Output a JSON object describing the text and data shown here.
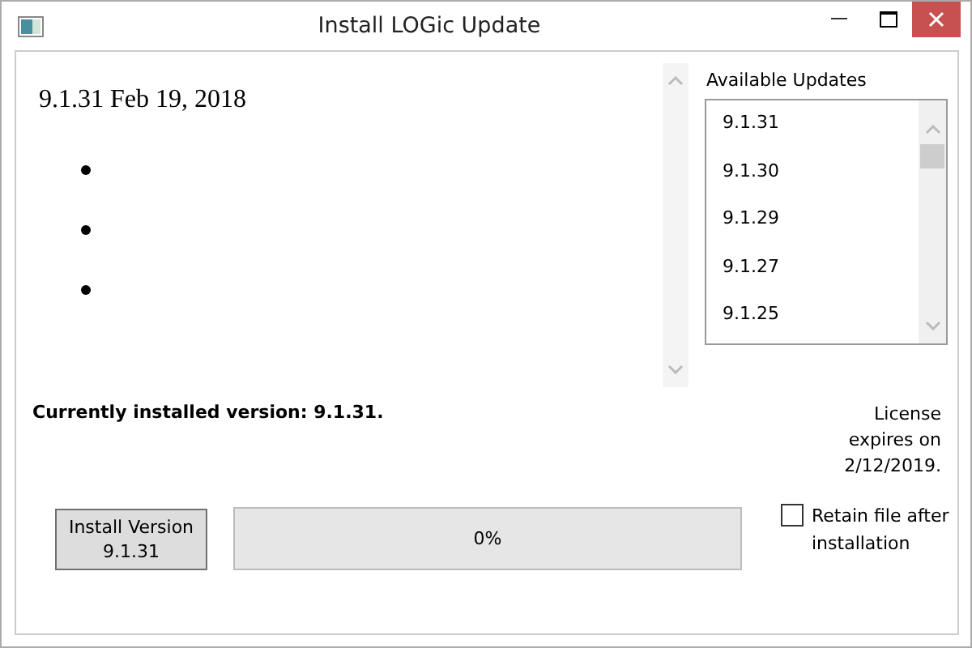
{
  "window": {
    "title": "Install LOGic Update"
  },
  "notes": {
    "heading": "9.1.31 Feb 19, 2018",
    "items": [
      {
        "kind": "bullet"
      },
      {
        "kind": "bullet"
      },
      {
        "kind": "bullet"
      }
    ]
  },
  "updates": {
    "label": "Available Updates",
    "items": [
      {
        "version": "9.1.31",
        "selected": false
      },
      {
        "version": "9.1.30",
        "selected": false
      },
      {
        "version": "9.1.29",
        "selected": false
      },
      {
        "version": "9.1.27",
        "selected": false
      },
      {
        "version": "9.1.25",
        "selected": false
      }
    ]
  },
  "installed": "Currently installed version: 9.1.31.",
  "license": [
    "License",
    "expires on",
    "2/12/2019."
  ],
  "install_button": [
    "Install Version",
    "9.1.31"
  ],
  "progress": {
    "level": 0,
    "reading": "0%"
  },
  "retain": {
    "label": [
      "Retain file after",
      "installation"
    ],
    "checked": false
  }
}
